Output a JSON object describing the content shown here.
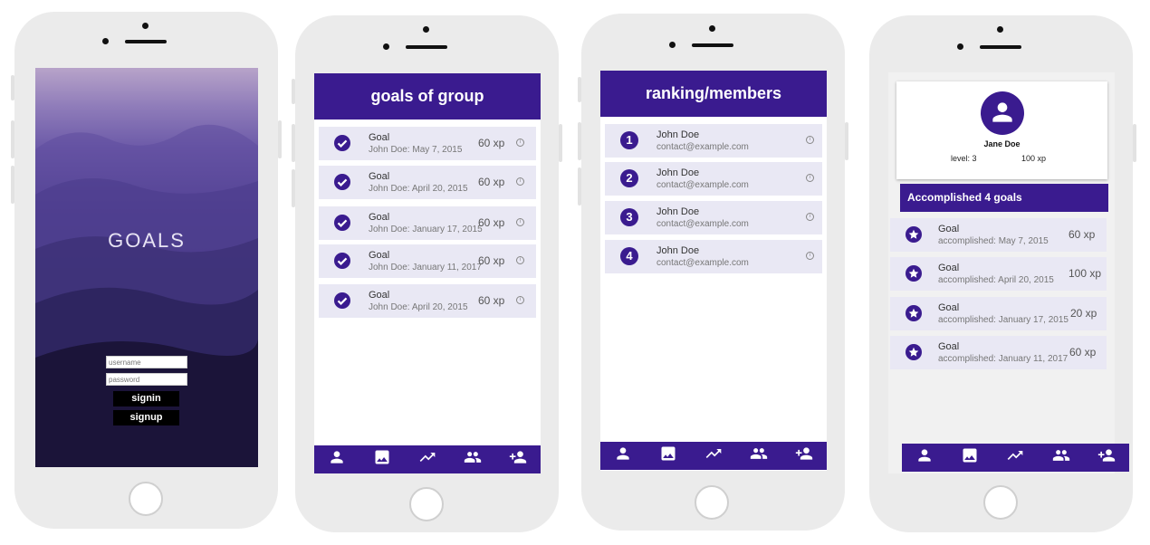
{
  "colors": {
    "brand": "#3a1b8f",
    "row": "#e9e8f4"
  },
  "login": {
    "logo": "GOALS",
    "username_placeholder": "username",
    "password_placeholder": "password",
    "signin_label": "signin",
    "signup_label": "signup"
  },
  "goals": {
    "title": "goals of group",
    "items": [
      {
        "title": "Goal",
        "sub": "John Doe: May 7, 2015",
        "xp": "60 xp"
      },
      {
        "title": "Goal",
        "sub": "John Doe: April 20, 2015",
        "xp": "60 xp"
      },
      {
        "title": "Goal",
        "sub": "John Doe: January 17, 2015",
        "xp": "60 xp"
      },
      {
        "title": "Goal",
        "sub": "John Doe: January 11, 2017",
        "xp": "60 xp"
      },
      {
        "title": "Goal",
        "sub": "John Doe: April 20, 2015",
        "xp": "60 xp"
      }
    ]
  },
  "ranking": {
    "title": "ranking/members",
    "items": [
      {
        "rank": "1",
        "name": "John Doe",
        "email": "contact@example.com"
      },
      {
        "rank": "2",
        "name": "John Doe",
        "email": "contact@example.com"
      },
      {
        "rank": "3",
        "name": "John Doe",
        "email": "contact@example.com"
      },
      {
        "rank": "4",
        "name": "John Doe",
        "email": "contact@example.com"
      }
    ]
  },
  "profile": {
    "name": "Jane Doe",
    "level": "level: 3",
    "xp": "100 xp",
    "accomplished_header": "Accomplished 4 goals",
    "items": [
      {
        "title": "Goal",
        "sub": "accomplished:  May 7, 2015",
        "xp": "60 xp"
      },
      {
        "title": "Goal",
        "sub": "accomplished:  April 20, 2015",
        "xp": "100 xp"
      },
      {
        "title": "Goal",
        "sub": "accomplished: January 17, 2015",
        "xp": "20 xp"
      },
      {
        "title": "Goal",
        "sub": "accomplished: January 11, 2017",
        "xp": "60 xp"
      }
    ]
  },
  "nav_icons": [
    "person-icon",
    "image-icon",
    "trending-icon",
    "group-icon",
    "person-add-icon"
  ]
}
